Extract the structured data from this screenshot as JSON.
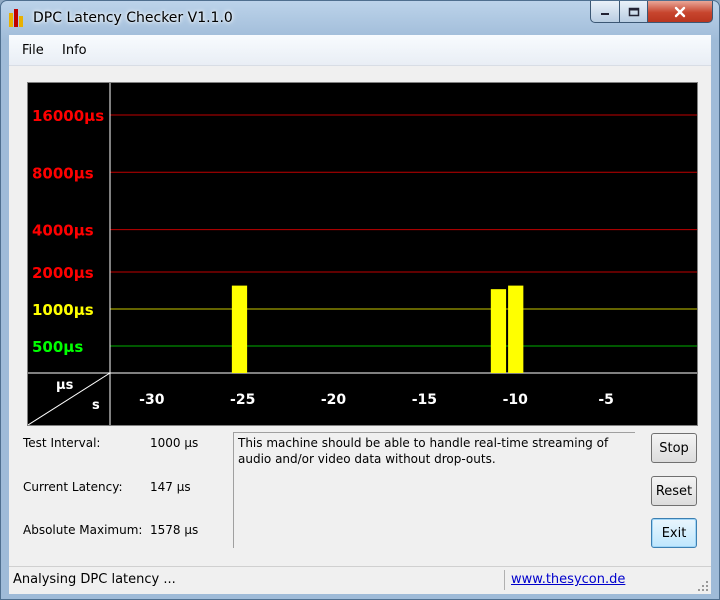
{
  "window": {
    "title": "DPC Latency Checker V1.1.0"
  },
  "menu": {
    "file": "File",
    "info": "Info"
  },
  "chart_data": {
    "type": "bar",
    "y_tick_labels": [
      {
        "label": "16000µs",
        "value": 16000,
        "color": "#ff0000"
      },
      {
        "label": "8000µs",
        "value": 8000,
        "color": "#ff0000"
      },
      {
        "label": "4000µs",
        "value": 4000,
        "color": "#ff0000"
      },
      {
        "label": "2000µs",
        "value": 2000,
        "color": "#ff0000"
      },
      {
        "label": "1000µs",
        "value": 1000,
        "color": "#ffff00"
      },
      {
        "label": "500µs",
        "value": 500,
        "color": "#00ff00"
      }
    ],
    "y_unit_label": "µs",
    "x_unit_label": "s",
    "x_tick_labels": [
      "-30",
      "-25",
      "-20",
      "-15",
      "-10",
      "-5"
    ],
    "x_ticks": [
      -30,
      -25,
      -20,
      -15,
      -10,
      -5
    ],
    "x_range": [
      -32.3,
      0
    ],
    "y_scale": "log",
    "colors": {
      "normal": "#00ff00",
      "warning": "#ffff00",
      "background": "#000000"
    },
    "values": [
      160,
      160,
      160,
      160,
      160,
      160,
      160,
      1550,
      160,
      160,
      160,
      160,
      160,
      145,
      160,
      160,
      160,
      160,
      160,
      145,
      130,
      160,
      1450,
      1550,
      160,
      160,
      140,
      160,
      160,
      160,
      160,
      140,
      160,
      160
    ]
  },
  "stats": {
    "test_interval_label": "Test Interval:",
    "test_interval_value": "1000 µs",
    "current_latency_label": "Current Latency:",
    "current_latency_value": "147 µs",
    "absolute_maximum_label": "Absolute Maximum:",
    "absolute_maximum_value": "1578 µs"
  },
  "message": "This machine should be able to handle real-time streaming of audio and/or video data without drop-outs.",
  "buttons": {
    "stop": "Stop",
    "reset": "Reset",
    "exit": "Exit"
  },
  "status": {
    "text": "Analysing DPC latency ...",
    "link": "www.thesycon.de"
  }
}
